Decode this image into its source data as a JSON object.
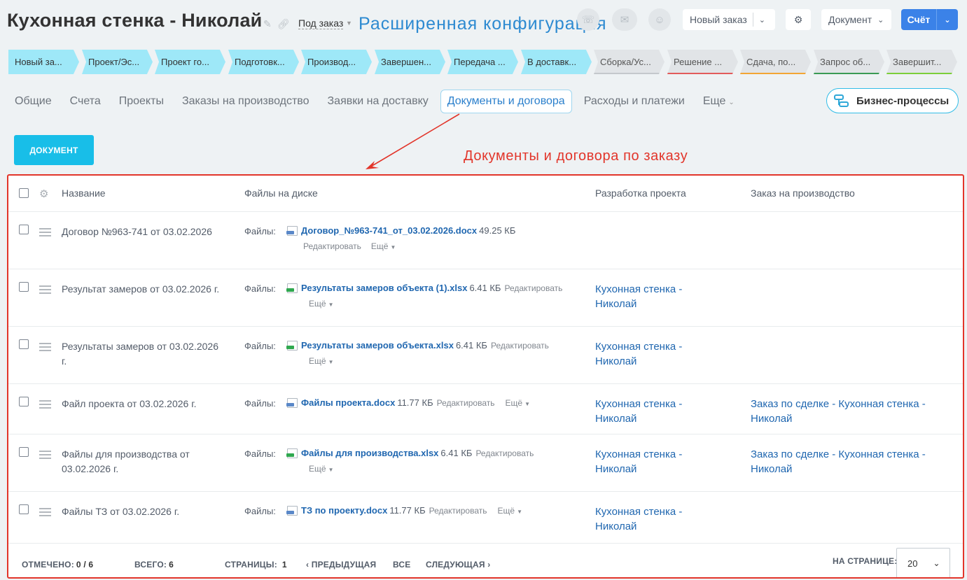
{
  "header": {
    "title": "Кухонная стенка - Николай",
    "deal_type": "Под заказ",
    "annotation_top": "Расширенная конфигурация",
    "new_order_label": "Новый заказ",
    "document_label": "Документ",
    "invoice_label": "Счёт"
  },
  "stages": [
    {
      "label": "Новый за...",
      "state": "active"
    },
    {
      "label": "Проект/Эс...",
      "state": "active"
    },
    {
      "label": "Проект го...",
      "state": "active"
    },
    {
      "label": "Подготовк...",
      "state": "active"
    },
    {
      "label": "Производ...",
      "state": "active"
    },
    {
      "label": "Завершен...",
      "state": "active"
    },
    {
      "label": "Передача ...",
      "state": "active"
    },
    {
      "label": "В доставк...",
      "state": "active"
    },
    {
      "label": "Сборка/Ус...",
      "state": "inactive",
      "bar": "#c4c8cc"
    },
    {
      "label": "Решение ...",
      "state": "inactive",
      "bar": "#e25b5b"
    },
    {
      "label": "Сдача, по...",
      "state": "inactive",
      "bar": "#f2a534"
    },
    {
      "label": "Запрос об...",
      "state": "inactive",
      "bar": "#3a9a54"
    },
    {
      "label": "Завершит...",
      "state": "inactive",
      "bar": "#7ccf3a"
    }
  ],
  "tabs": [
    {
      "label": "Общие"
    },
    {
      "label": "Счета"
    },
    {
      "label": "Проекты"
    },
    {
      "label": "Заказы на производство"
    },
    {
      "label": "Заявки на доставку"
    },
    {
      "label": "Документы и договора",
      "selected": true
    },
    {
      "label": "Расходы и платежи"
    },
    {
      "label": "Еще"
    }
  ],
  "business_processes_label": "Бизнес-процессы",
  "add_document_label": "ДОКУМЕНТ",
  "annotation_mid": "Документы и договора по заказу",
  "table": {
    "columns": {
      "name": "Название",
      "files": "Файлы на диске",
      "project": "Разработка проекта",
      "production": "Заказ на производство"
    },
    "files_label": "Файлы:",
    "edit_label": "Редактировать",
    "more_label": "Ещё",
    "rows": [
      {
        "name": "Договор №963-741 от 03.02.2026",
        "file": "Договор_№963-741_от_03.02.2026.docx",
        "size": "49.25 КБ",
        "project": "",
        "production": ""
      },
      {
        "name": "Результат замеров от 03.02.2026 г.",
        "file": "Результаты замеров объекта (1).xlsx",
        "size": "6.41 КБ",
        "project": "Кухонная стенка - Николай",
        "production": ""
      },
      {
        "name": "Результаты замеров от 03.02.2026 г.",
        "file": "Результаты замеров объекта.xlsx",
        "size": "6.41 КБ",
        "project": "Кухонная стенка - Николай",
        "production": ""
      },
      {
        "name": "Файл проекта от 03.02.2026 г.",
        "file": "Файлы проекта.docx",
        "size": "11.77 КБ",
        "project": "Кухонная стенка - Николай",
        "production": "Заказ по сделке - Кухонная стенка - Николай"
      },
      {
        "name": "Файлы для производства от 03.02.2026 г.",
        "file": "Файлы для производства.xlsx",
        "size": "6.41 КБ",
        "project": "Кухонная стенка - Николай",
        "production": "Заказ по сделке - Кухонная стенка - Николай"
      },
      {
        "name": "Файлы ТЗ от 03.02.2026 г.",
        "file": "ТЗ по проекту.docx",
        "size": "11.77 КБ",
        "project": "Кухонная стенка - Николай",
        "production": ""
      }
    ]
  },
  "footer": {
    "selected_label": "ОТМЕЧЕНО:",
    "selected_value": "0 / 6",
    "total_label": "ВСЕГО:",
    "total_value": "6",
    "pages_label": "СТРАНИЦЫ:",
    "pages_value": "1",
    "prev_label": "ПРЕДЫДУЩАЯ",
    "all_label": "ВСЕ",
    "next_label": "СЛЕДУЮЩАЯ",
    "per_page_label": "НА СТРАНИЦЕ:",
    "per_page_value": "20"
  }
}
